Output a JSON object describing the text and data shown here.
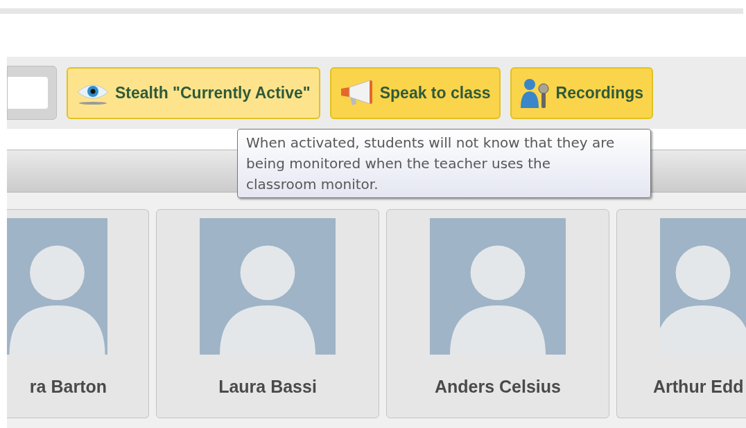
{
  "toolbar": {
    "buttons": [
      {
        "kind": "stealth",
        "label": "Stealth \"Currently Active\"",
        "active": true
      },
      {
        "kind": "speak",
        "label": "Speak to class",
        "active": false
      },
      {
        "kind": "recordings",
        "label": "Recordings",
        "active": false
      }
    ]
  },
  "tooltip": {
    "text": "When activated, students will not know that they are being monitored when the teacher uses the classroom monitor."
  },
  "students": [
    {
      "kind": "cut_left",
      "name": "ra Barton"
    },
    {
      "kind": "whole",
      "name": "Laura Bassi"
    },
    {
      "kind": "whole",
      "name": "Anders Celsius"
    },
    {
      "kind": "cut_right",
      "name": "Arthur Edd"
    }
  ]
}
